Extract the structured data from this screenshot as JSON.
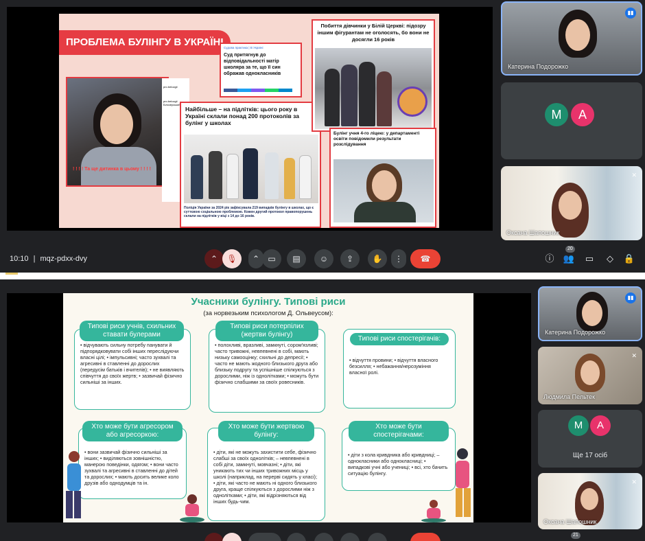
{
  "call1": {
    "slide": {
      "title": "ПРОБЛЕМА БУЛІНГУ В УКРАЇНІ",
      "article_mother": "Суд притягнув до відповідальності матір школяра за те, що її син ображав однокласників",
      "article_mother_meta": "Судова практика | В Україні",
      "article_teens": "Найбільше – на підлітків: цього року в Україні склали понад 200 протоколів за булінг у школах",
      "article_teens_caption": "Поліція України за 2024 рік зафіксувала 219 випадків булінгу в школах, що є суттєвою соціальною проблемою. Кожен другий протокол правопорушень склали на підлітків у віці з 14 до 16 років.",
      "article_bila": "Побиття дівчинки у Білій Церкві: підозру іншим фігурантам не оголосять, бо вони не досягли 16 років",
      "article_lyceum": "Булінг учня 4-го ліцею: у департаменті освіти повідомили результати розслідування",
      "video_subtitle": "! ! ! ! Та ще дитинка в цьому ! ! ! !",
      "insta_user": "pro.belozgii",
      "insta_user2": "pro.belozgii Білозерський"
    },
    "participants": [
      {
        "name": "Катерина Подорожко",
        "speaking": true
      },
      {
        "avatars": [
          "М",
          "А"
        ]
      },
      {
        "name": "Оксана Шапошник",
        "muted": true
      }
    ],
    "toolbar": {
      "time": "10:10",
      "separator": "|",
      "code": "mqz-pdxx-dvy",
      "people_count": "20"
    }
  },
  "call2": {
    "slide": {
      "title": "Учасники булінгу. Типові риси",
      "subtitle": "(за норвезьким психологом Д. Ольвеусом):",
      "bullies_title": "Типові риси учнів, схильних ставати булерами",
      "bullies_text": "• відчувають сильну потребу панувати й підпорядковувати собі інших переслідуючи власні цілі; • імпульсивні; часто зухвалі та агресивні в ставленні до дорослих (передусім батьків і вчителів); • не виявляють співчуття до своїх жертв; • зазвичай фізично сильніші за інших.",
      "victims_title": "Типові риси потерпілих (жертви булінгу)",
      "victims_text": "• полохливі, вразливі, замкнуті, сором'язливі; часто тривожні, невпевнені в собі, мають низьку самооцінку; схильні до депресії; • часто не мають жодного близького друга або близьку подругу та успішніше спілкуються з дорослими, ніж із однолітками; • можуть бути фізично слабшими за своїх ровесників.",
      "observers_title": "Типові риси спостерігачів:",
      "observers_text": "• відчуття провини; • відчуття власного безсилля; • небажання/нерозуміння власної ролі.",
      "aggressor_title": "Хто може бути агресором або агресоркою:",
      "aggressor_text": "• вони зазвичай фізично сильніші за інших; • виділяються зовнішністю, манерою поведінки, одягом; • вони часто зухвалі та агресивні в ставленні до дітей та дорослих; • мають досить велике коло друзів або однодумців та ін.",
      "victim_who_title": "Хто може бути жертвою булінгу:",
      "victim_who_text": "• діти, які не можуть захистити себе, фізично слабші за своїх однолітків; – невпевнені в собі діти, замкнуті, мовчазні; • діти, які уникають тих чи інших тривожних місць у школі (наприклад, на перерві сидять у класі); • діти, які часто не мають ні одного близького друга, краще спілкуються з дорослими ніж з однолітками; • діти, які відрізняються від інших будь-чим.",
      "observer_who_title": "Хто може бути спостерігачами:",
      "observer_who_text": "• діти з кола кривдника або кривдниці; – однокласники або однокласниці; • випадкові учні або учениці; • всі, хто бачить ситуацію булінгу."
    },
    "participants": [
      {
        "name": "Катерина Подорожко",
        "speaking": true
      },
      {
        "name": "Людмила Пельтек",
        "muted": true
      },
      {
        "avatars": [
          "М",
          "А"
        ],
        "label": "Ще 17 осіб"
      },
      {
        "name": "Оксана Шапошник",
        "muted": true
      }
    ],
    "people_count": "21"
  },
  "colors": {
    "meet_bg": "#202124",
    "slide1_accent": "#e33b41",
    "slide2_accent": "#35b69c",
    "end_call": "#ea4335"
  },
  "icons": [
    "mic-off-icon",
    "camera-icon",
    "captions-icon",
    "emoji-icon",
    "present-icon",
    "hand-icon",
    "more-icon",
    "end-call-icon",
    "info-icon",
    "people-icon",
    "chat-icon",
    "activities-icon",
    "host-controls-icon"
  ]
}
